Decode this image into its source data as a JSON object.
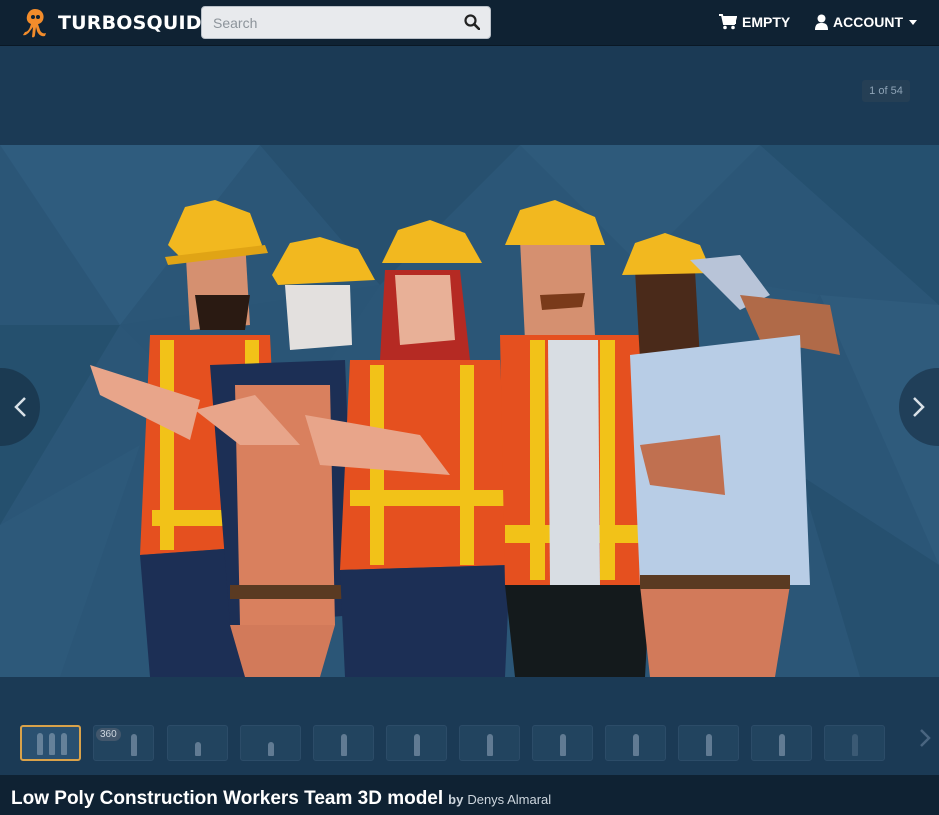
{
  "header": {
    "brand": "TURBOSQUID",
    "search_placeholder": "Search",
    "cart_label": "EMPTY",
    "account_label": "ACCOUNT"
  },
  "viewer": {
    "counter": "1 of 54",
    "thumbnail_count": 12,
    "badge_360": "360"
  },
  "product": {
    "title": "Low Poly Construction Workers Team 3D model",
    "by": "by",
    "author": "Denys Almaral"
  },
  "colors": {
    "header_bg": "#0f2233",
    "page_bg": "#1b3a55",
    "accent_active_thumb": "#d9a24a",
    "brand_orange": "#f28c2b"
  },
  "icons": {
    "logo": "squid-logo-icon",
    "search": "search-icon",
    "cart": "cart-icon",
    "account": "user-icon",
    "prev": "chevron-left-icon",
    "next": "chevron-right-icon"
  }
}
